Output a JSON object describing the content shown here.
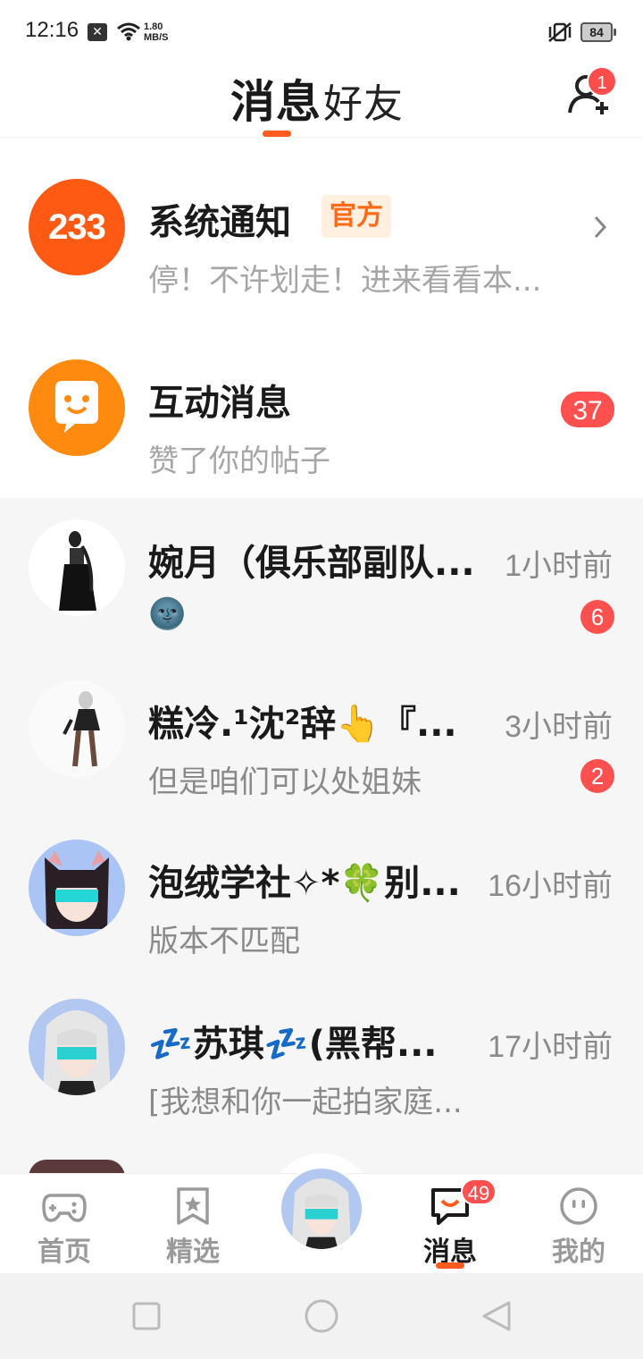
{
  "status_bar": {
    "time": "12:16",
    "notification_glyph": "✕",
    "speed_value": "1.80",
    "speed_unit": "MB/S",
    "battery": "84"
  },
  "header": {
    "tabs": [
      {
        "label": "消息",
        "active": true
      },
      {
        "label": "好友",
        "active": false
      }
    ],
    "add_friend_badge": "1"
  },
  "official": [
    {
      "title": "系统通知",
      "tag": "官方",
      "preview": "停！不许划走！进来看看本...",
      "avatar_text": "233",
      "color": "#ff5a14"
    },
    {
      "title": "互动消息",
      "preview": "赞了你的帖子",
      "badge": "37",
      "color": "#ff8a10"
    }
  ],
  "chats": [
    {
      "name": "婉月（俱乐部副队...",
      "preview": "🌚",
      "time": "1小时前",
      "badge": "6"
    },
    {
      "name": "糕冷.¹沈²辞👆『...",
      "preview": "但是咱们可以处姐妹",
      "time": "3小时前",
      "badge": "2"
    },
    {
      "name": "泡绒学社✧*🍀别...",
      "preview": "版本不匹配",
      "time": "16小时前",
      "badge": null
    },
    {
      "name": "💤苏琪💤(黑帮...",
      "preview": "[我想和你一起拍家庭...",
      "time": "17小时前",
      "badge": null
    }
  ],
  "bottom_nav": {
    "items": [
      {
        "label": "首页",
        "icon": "gamepad-icon"
      },
      {
        "label": "精选",
        "icon": "star-bookmark-icon"
      },
      {
        "label": "消息",
        "icon": "chat-bubble-icon",
        "badge": "49",
        "active": true
      },
      {
        "label": "我的",
        "icon": "smiley-face-icon"
      }
    ]
  },
  "colors": {
    "accent": "#ff5a1f",
    "badge": "#ff5050",
    "muted_text": "#a6a6a6",
    "chat_bg": "#f6f6f6"
  }
}
